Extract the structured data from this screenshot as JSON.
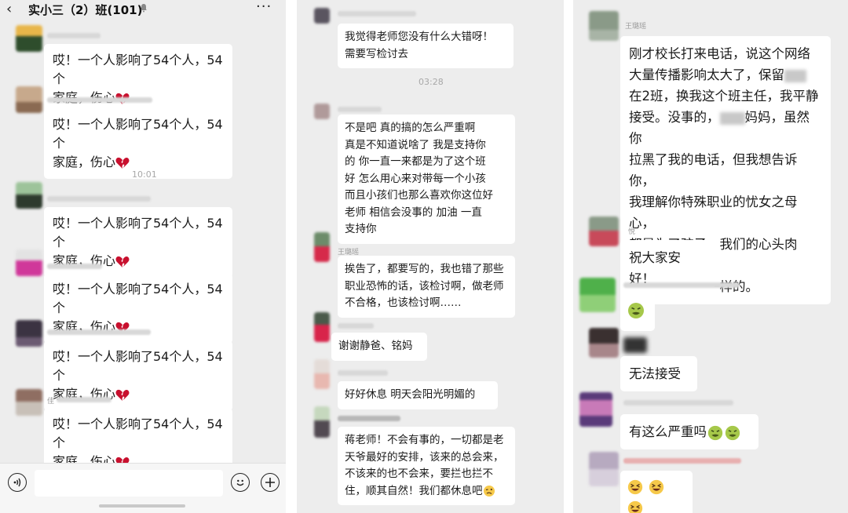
{
  "chat_header": {
    "back_glyph": "‹",
    "title": "实小三（2）班(101)",
    "more_glyph": "···"
  },
  "panel1": {
    "repeated_message": [
      "哎！一个人影响了54个人，54个",
      "家庭，伤心"
    ],
    "timestamp": "10:01",
    "nicknames": {
      "m6": "佳"
    }
  },
  "panel2": {
    "timestamp": "03:28",
    "messages": [
      {
        "lines": [
          "我觉得老师您没有什么大错呀！",
          "需要写检讨去"
        ]
      },
      {
        "lines": [
          "不是吧  真的搞的怎么严重啊",
          "真是不知道说啥了   我是支持你",
          "的  你一直一来都是为了这个班",
          "好  怎么用心来对带每一个小孩",
          "而且小孩们也那么喜欢你这位好",
          "老师  相信会没事的   加油  一直",
          "支持你"
        ]
      },
      {
        "lines": [
          "挨告了，都要写的，我也错了那些",
          "职业恐怖的话，该检讨啊，做老师",
          "不合格，也该检讨啊……"
        ]
      },
      {
        "lines": [
          "谢谢静爸、铭妈"
        ]
      },
      {
        "lines": [
          "好好休息  明天会阳光明媚的"
        ]
      },
      {
        "lines": [
          "蒋老师！不会有事的，一切都是老",
          "天爷最好的安排，该来的总会来，",
          "不该来的也不会来，要拦也拦不",
          "住，顺其自然！我们都休息吧"
        ]
      }
    ],
    "nicknames": {
      "m3": "王璐瑶"
    }
  },
  "panel3": {
    "messages": [
      {
        "lines": [
          "刚才校长打来电话，说这个网络",
          "大量传播影响太大了，保留",
          "在2班，换我这个班主任，我平静",
          "接受。没事的，",
          "拉黑了我的电话，但我想告诉你，",
          "我理解你特殊职业的忧女之母心，",
          "都是为了孩子，我们的心头肉好，",
          "我教哪个班都一样的。"
        ],
        "inline_tail": "妈妈，虽然你"
      },
      {
        "lines": [
          "祝大家安好！"
        ]
      },
      {
        "lines": [
          "无法接受"
        ]
      },
      {
        "lines": [
          "有这么严重吗"
        ]
      }
    ],
    "nicknames": {
      "m1": "王璐瑶",
      "m2": "悦"
    }
  },
  "icons": {
    "mute": "bell-muted-icon",
    "broken_heart": "broken-heart-emoji",
    "sick": "sick-face-emoji",
    "grin": "grinning-squint-emoji",
    "woozy": "woozy-face-emoji",
    "voice": "voice-icon",
    "emoji_btn": "smiley-icon",
    "add": "plus-icon"
  },
  "colors": {
    "bubble": "#ffffff",
    "background": "#ededed",
    "heart": "#c8102e"
  }
}
